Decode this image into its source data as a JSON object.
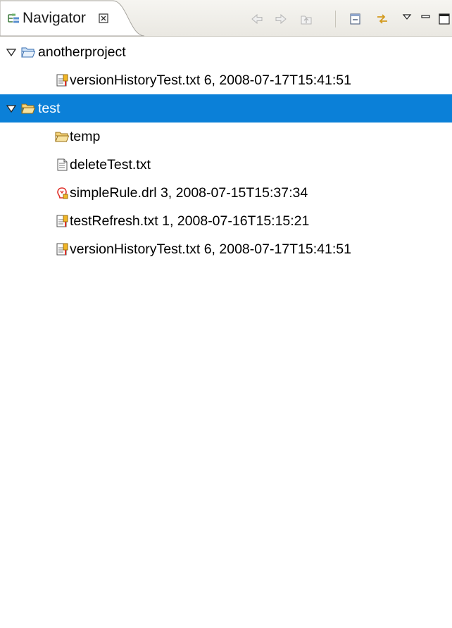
{
  "view": {
    "tab_title": "Navigator",
    "tab_close_glyph": "⊠",
    "toolbar_icons": [
      "back-arrow-icon",
      "forward-arrow-icon",
      "up-folder-icon",
      "collapse-all-icon",
      "link-with-editor-icon",
      "view-menu-icon",
      "minimize-icon",
      "maximize-icon"
    ]
  },
  "tree": {
    "project1": {
      "label": "anotherproject",
      "expanded": true,
      "icon": "open-folder-icon",
      "children": [
        {
          "label": "versionHistoryTest.txt 6, 2008-07-17T15:41:51",
          "icon": "versioned-text-file-icon"
        }
      ]
    },
    "project2": {
      "label": "test",
      "expanded": true,
      "selected": true,
      "icon": "open-folder-icon",
      "children": [
        {
          "label": "temp",
          "icon": "open-folder-icon"
        },
        {
          "label": "deleteTest.txt",
          "icon": "text-file-icon"
        },
        {
          "label": "simpleRule.drl 3, 2008-07-15T15:37:34",
          "icon": "rule-file-icon"
        },
        {
          "label": "testRefresh.txt 1, 2008-07-16T15:15:21",
          "icon": "versioned-text-file-icon"
        },
        {
          "label": "versionHistoryTest.txt 6, 2008-07-17T15:41:51",
          "icon": "versioned-text-file-icon"
        }
      ]
    }
  },
  "colors": {
    "selection": "#0b80d8",
    "folder": "#e9b43a",
    "rule_icon": "#e0322b"
  }
}
